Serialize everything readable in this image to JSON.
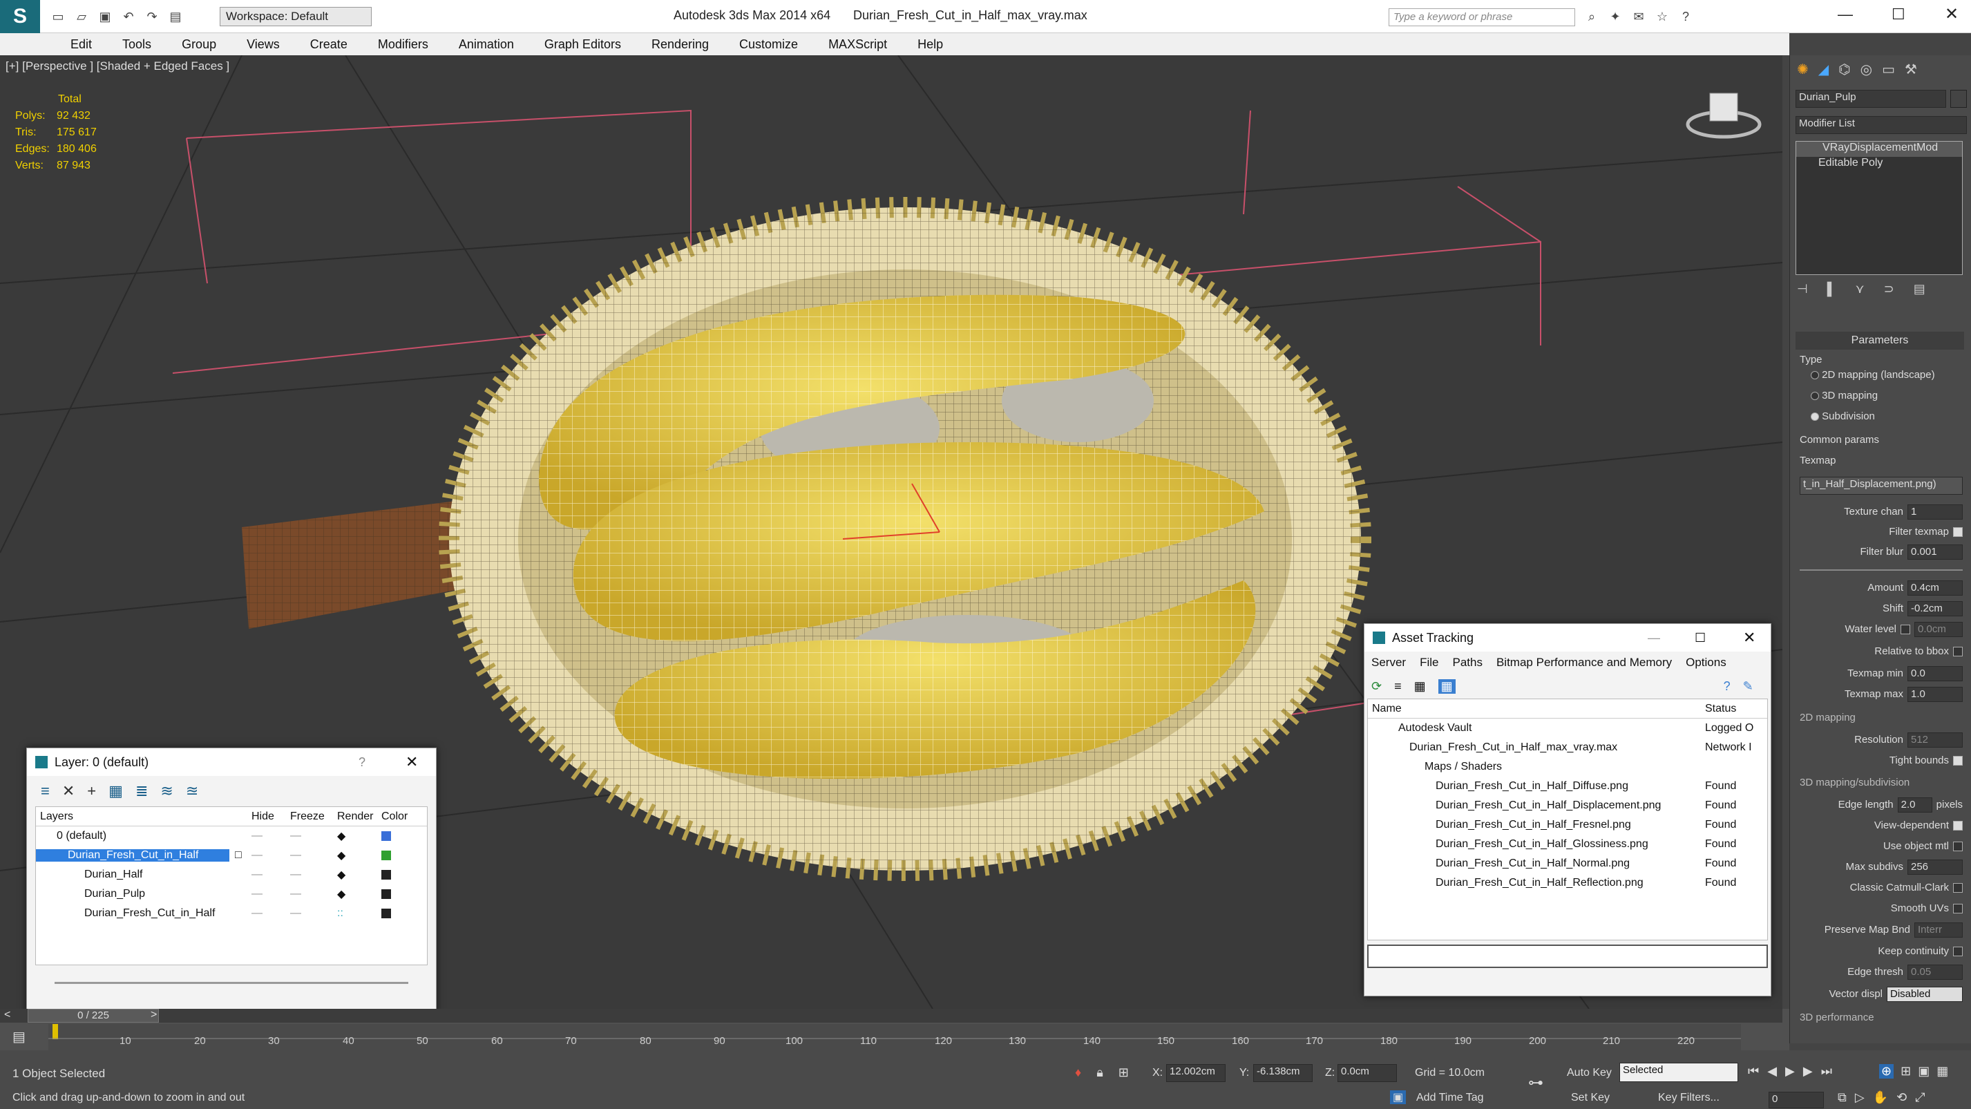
{
  "titlebar": {
    "workspace_label": "Workspace: Default",
    "app_title": "Autodesk 3ds Max  2014 x64",
    "file_title": "Durian_Fresh_Cut_in_Half_max_vray.max",
    "search_placeholder": "Type a keyword or phrase"
  },
  "menu": [
    "Edit",
    "Tools",
    "Group",
    "Views",
    "Create",
    "Modifiers",
    "Animation",
    "Graph Editors",
    "Rendering",
    "Customize",
    "MAXScript",
    "Help"
  ],
  "viewport": {
    "label": "[+] [Perspective ] [Shaded + Edged Faces ]",
    "stats_header": "Total",
    "stats": [
      {
        "k": "Polys:",
        "v": "92 432"
      },
      {
        "k": "Tris:",
        "v": "175 617"
      },
      {
        "k": "Edges:",
        "v": "180 406"
      },
      {
        "k": "Verts:",
        "v": "87 943"
      }
    ]
  },
  "layer_window": {
    "title": "Layer: 0 (default)",
    "help": "?",
    "columns": [
      "Layers",
      "Hide",
      "Freeze",
      "Render",
      "Color"
    ],
    "rows": [
      {
        "name": "0 (default)",
        "color": "#3a6fd8"
      },
      {
        "name": "Durian_Fresh_Cut_in_Half",
        "color": "#2fa02f"
      },
      {
        "name": "Durian_Half",
        "color": "#222222"
      },
      {
        "name": "Durian_Pulp",
        "color": "#222222"
      },
      {
        "name": "Durian_Fresh_Cut_in_Half",
        "color": "#222222"
      }
    ]
  },
  "asset_window": {
    "title": "Asset Tracking",
    "menu": [
      "Server",
      "File",
      "Paths",
      "Bitmap Performance and Memory",
      "Options"
    ],
    "columns": [
      "Name",
      "Status"
    ],
    "rows": [
      {
        "name": "Autodesk Vault",
        "status": "Logged O"
      },
      {
        "name": "Durian_Fresh_Cut_in_Half_max_vray.max",
        "status": "Network I"
      },
      {
        "name": "Maps / Shaders",
        "status": ""
      },
      {
        "name": "Durian_Fresh_Cut_in_Half_Diffuse.png",
        "status": "Found"
      },
      {
        "name": "Durian_Fresh_Cut_in_Half_Displacement.png",
        "status": "Found"
      },
      {
        "name": "Durian_Fresh_Cut_in_Half_Fresnel.png",
        "status": "Found"
      },
      {
        "name": "Durian_Fresh_Cut_in_Half_Glossiness.png",
        "status": "Found"
      },
      {
        "name": "Durian_Fresh_Cut_in_Half_Normal.png",
        "status": "Found"
      },
      {
        "name": "Durian_Fresh_Cut_in_Half_Reflection.png",
        "status": "Found"
      }
    ]
  },
  "command_panel": {
    "object_name": "Durian_Pulp",
    "modifier_list": "Modifier List",
    "stack": [
      "VRayDisplacementMod",
      "Editable Poly"
    ],
    "rollout_title": "Parameters",
    "type_label": "Type",
    "type_options": [
      "2D mapping (landscape)",
      "3D mapping",
      "Subdivision"
    ],
    "common_params": "Common params",
    "texmap_label": "Texmap",
    "texmap_value": "t_in_Half_Displacement.png)",
    "texture_chan_label": "Texture chan",
    "texture_chan": "1",
    "filter_texmap": "Filter texmap",
    "filter_blur_label": "Filter blur",
    "filter_blur": "0.001",
    "amount_label": "Amount",
    "amount": "0.4cm",
    "shift_label": "Shift",
    "shift": "-0.2cm",
    "water_label": "Water level",
    "water": "0.0cm",
    "relative_bbox": "Relative to bbox",
    "texmap_min_label": "Texmap min",
    "texmap_min": "0.0",
    "texmap_max_label": "Texmap max",
    "texmap_max": "1.0",
    "mapping2d": "2D mapping",
    "resolution_label": "Resolution",
    "resolution": "512",
    "tight_bounds": "Tight bounds",
    "mapping3d": "3D mapping/subdivision",
    "edge_length_label": "Edge length",
    "edge_length": "2.0",
    "pixels": "pixels",
    "view_dependent": "View-dependent",
    "use_object_mtl": "Use object mtl",
    "max_subdivs_label": "Max subdivs",
    "max_subdivs": "256",
    "catmull": "Classic Catmull-Clark",
    "smooth_uvs": "Smooth UVs",
    "preserve_label": "Preserve Map Bnd",
    "preserve_value": "Interr",
    "keep_continuity": "Keep continuity",
    "edge_thresh_label": "Edge thresh",
    "edge_thresh": "0.05",
    "vector_label": "Vector displ",
    "vector_value": "Disabled",
    "performance": "3D performance"
  },
  "timeline": {
    "frame_label": "0 / 225",
    "ticks": [
      "10",
      "20",
      "30",
      "40",
      "50",
      "60",
      "70",
      "80",
      "90",
      "100",
      "110",
      "120",
      "130",
      "140",
      "150",
      "160",
      "170",
      "180",
      "190",
      "200",
      "210",
      "220"
    ]
  },
  "status": {
    "selected": "1 Object Selected",
    "hint": "Click and drag up-and-down to zoom in and out",
    "x_label": "X:",
    "x": "12.002cm",
    "y_label": "Y:",
    "y": "-6.138cm",
    "z_label": "Z:",
    "z": "0.0cm",
    "grid": "Grid = 10.0cm",
    "add_time_tag": "Add Time Tag",
    "auto_key": "Auto Key",
    "set_key": "Set Key",
    "selected_dropdown": "Selected",
    "key_filters": "Key Filters...",
    "frame_field": "0"
  }
}
